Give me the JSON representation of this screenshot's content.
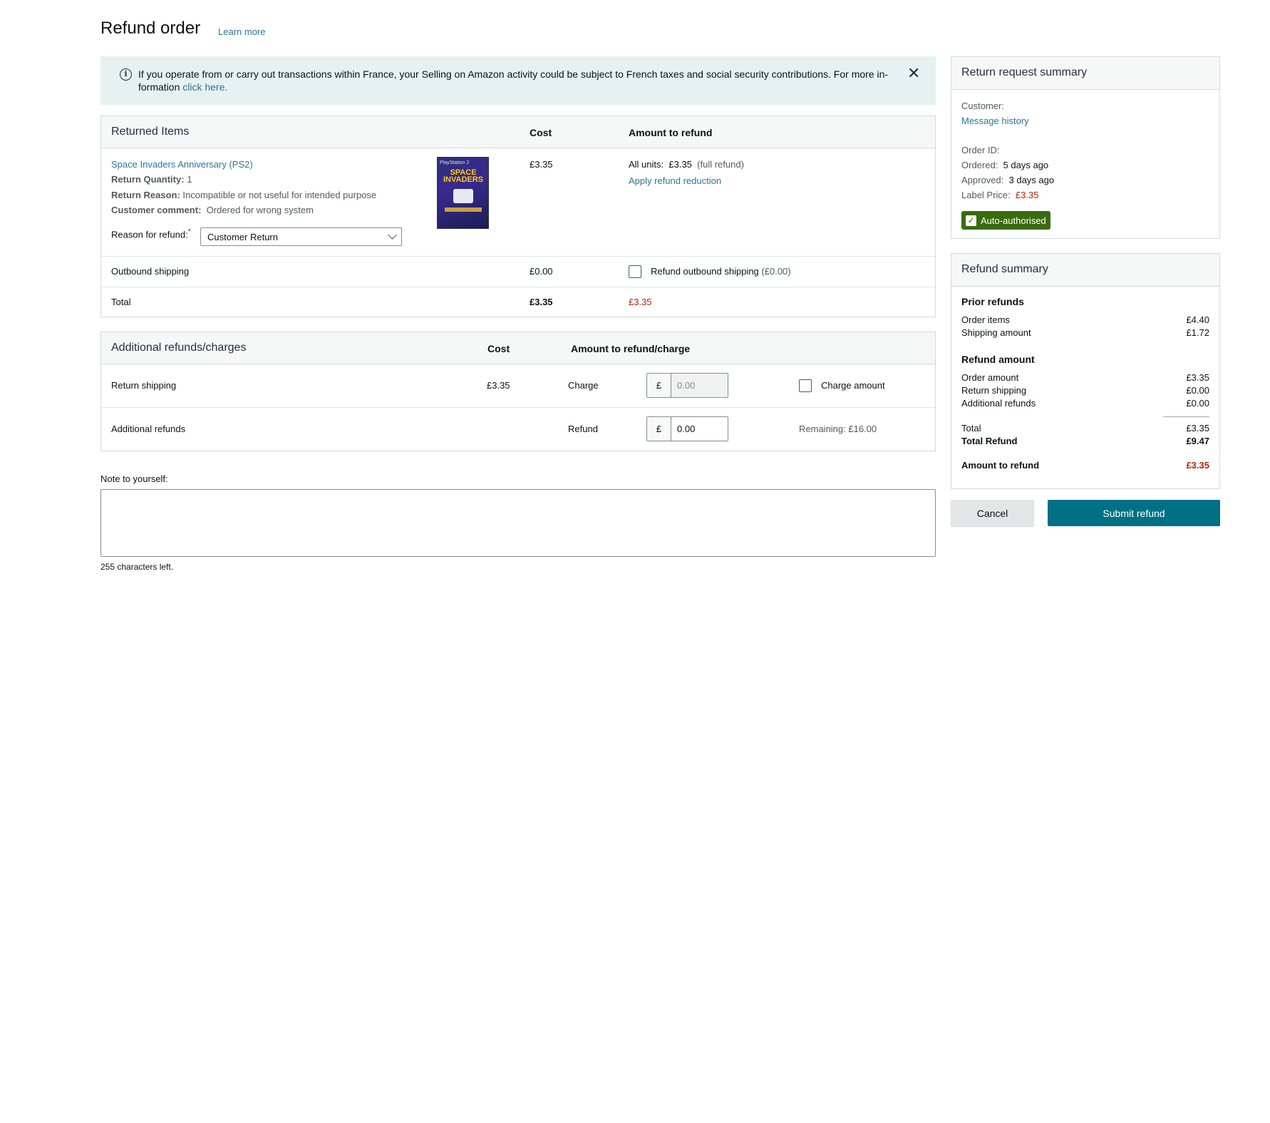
{
  "header": {
    "title": "Refund order",
    "learn_more": "Learn more"
  },
  "banner": {
    "text": "If you operate from or carry out transactions within France, your Selling on Amazon activity could be subject to French taxes and social security contributions. For more in-formation",
    "link": "click here.",
    "close_icon": "close-icon"
  },
  "returned_items": {
    "title": "Returned Items",
    "col_cost": "Cost",
    "col_amount": "Amount to refund",
    "product_name": "Space Invaders Anniversary (PS2)",
    "return_qty_label": "Return Quantity:",
    "return_qty": "1",
    "return_reason_label": "Return Reason:",
    "return_reason": "Incompatible or not useful for intended purpose",
    "customer_comment_label": "Customer comment:",
    "customer_comment": "Ordered for wrong system",
    "reason_for_refund_label": "Reason for refund:",
    "required_mark": "*",
    "reason_for_refund_value": "Customer Return",
    "cost": "£3.35",
    "all_units_label": "All units:",
    "all_units_value": "£3.35",
    "full_refund": "(full refund)",
    "apply_reduction": "Apply refund reduction",
    "image_text_top": "PlayStation 2",
    "image_text_title": "SPACE INVADERS",
    "outbound_label": "Outbound shipping",
    "outbound_cost": "£0.00",
    "outbound_refund_label": "Refund outbound shipping",
    "outbound_refund_amount": "(£0.00)",
    "total_label": "Total",
    "total_cost": "£3.35",
    "total_refund": "£3.35"
  },
  "additional": {
    "title": "Additional refunds/charges",
    "col_cost": "Cost",
    "col_amount": "Amount to refund/charge",
    "return_shipping_label": "Return shipping",
    "return_shipping_cost": "£3.35",
    "charge_label": "Charge",
    "currency": "£",
    "charge_value": "0.00",
    "charge_amount_label": "Charge amount",
    "additional_refunds_label": "Additional refunds",
    "refund_label": "Refund",
    "refund_value": "0.00",
    "remaining": "Remaining: £16.00"
  },
  "note": {
    "label": "Note to yourself:",
    "value": "",
    "chars_left": "255 characters left."
  },
  "return_summary": {
    "title": "Return request summary",
    "customer_label": "Customer:",
    "message_history": "Message history",
    "order_id_label": "Order ID:",
    "ordered_label": "Ordered:",
    "ordered_value": "5 days ago",
    "approved_label": "Approved:",
    "approved_value": "3 days ago",
    "label_price_label": "Label Price:",
    "label_price_value": "£3.35",
    "badge": "Auto-authorised"
  },
  "refund_summary": {
    "title": "Refund summary",
    "prior_refunds": "Prior refunds",
    "order_items_label": "Order items",
    "order_items_value": "£4.40",
    "shipping_amount_label": "Shipping amount",
    "shipping_amount_value": "£1.72",
    "refund_amount": "Refund amount",
    "order_amount_label": "Order amount",
    "order_amount_value": "£3.35",
    "return_shipping_label": "Return shipping",
    "return_shipping_value": "£0.00",
    "additional_refunds_label": "Additional refunds",
    "additional_refunds_value": "£0.00",
    "total_label": "Total",
    "total_value": "£3.35",
    "total_refund_label": "Total Refund",
    "total_refund_value": "£9.47",
    "amount_to_refund_label": "Amount to refund",
    "amount_to_refund_value": "£3.35"
  },
  "actions": {
    "cancel": "Cancel",
    "submit": "Submit refund"
  },
  "colors": {
    "link": "#2a7596",
    "price_red": "#b12704",
    "primary": "#007185",
    "badge_green": "#3a6b0e",
    "banner_bg": "#e6f2f2"
  }
}
